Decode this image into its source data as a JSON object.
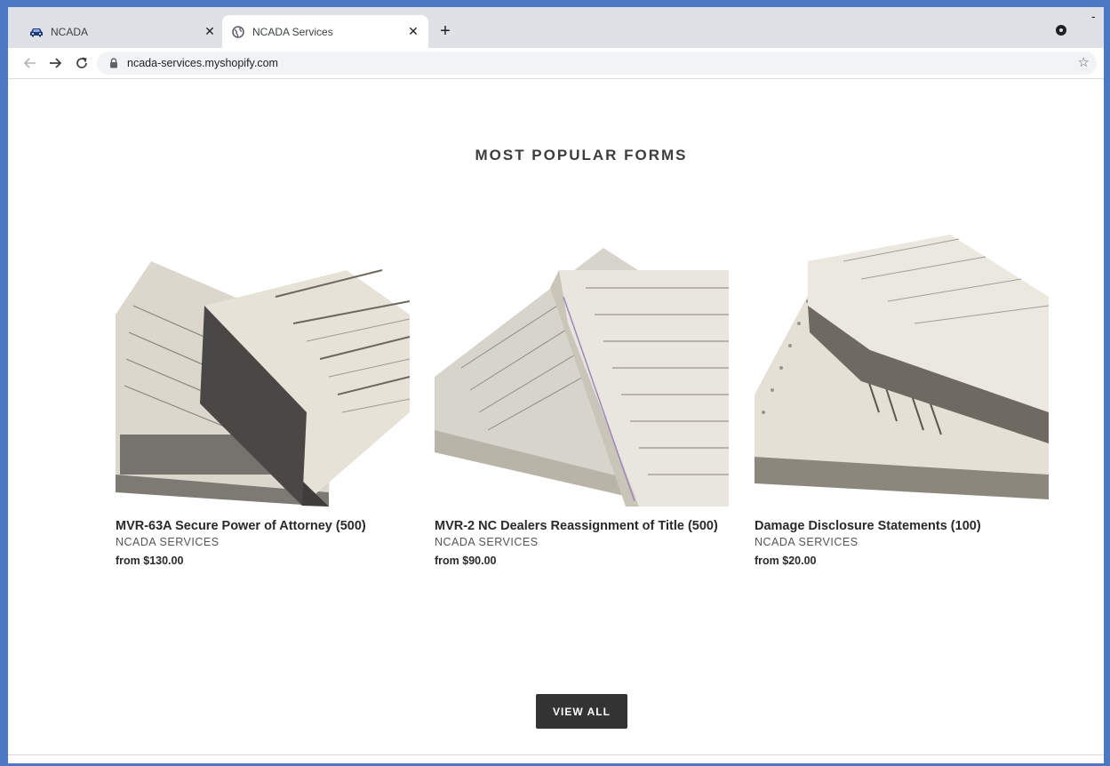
{
  "browser": {
    "tabs": [
      {
        "title": "NCADA",
        "icon": "car-icon",
        "active": false
      },
      {
        "title": "NCADA Services",
        "icon": "globe-icon",
        "active": true
      }
    ],
    "new_tab_label": "+",
    "close_label": "✕",
    "url": "ncada-services.myshopify.com",
    "minimize_label": "-"
  },
  "page": {
    "section_title": "MOST POPULAR FORMS",
    "products": [
      {
        "name": "MVR-63A Secure Power of Attorney (500)",
        "vendor": "NCADA SERVICES",
        "price": "from $130.00",
        "image_alt": "Stack of MVR-63A forms"
      },
      {
        "name": "MVR-2 NC Dealers Reassignment of Title (500)",
        "vendor": "NCADA SERVICES",
        "price": "from $90.00",
        "image_alt": "Stack of MVR-2 forms"
      },
      {
        "name": "Damage Disclosure Statements (100)",
        "vendor": "NCADA SERVICES",
        "price": "from $20.00",
        "image_alt": "Stack of damage disclosure statements"
      }
    ],
    "view_all_label": "VIEW ALL"
  },
  "colors": {
    "frame": "#4a78c2",
    "tab_strip": "#dee1e6",
    "button": "#333333",
    "title_text": "#3d3d3d"
  }
}
